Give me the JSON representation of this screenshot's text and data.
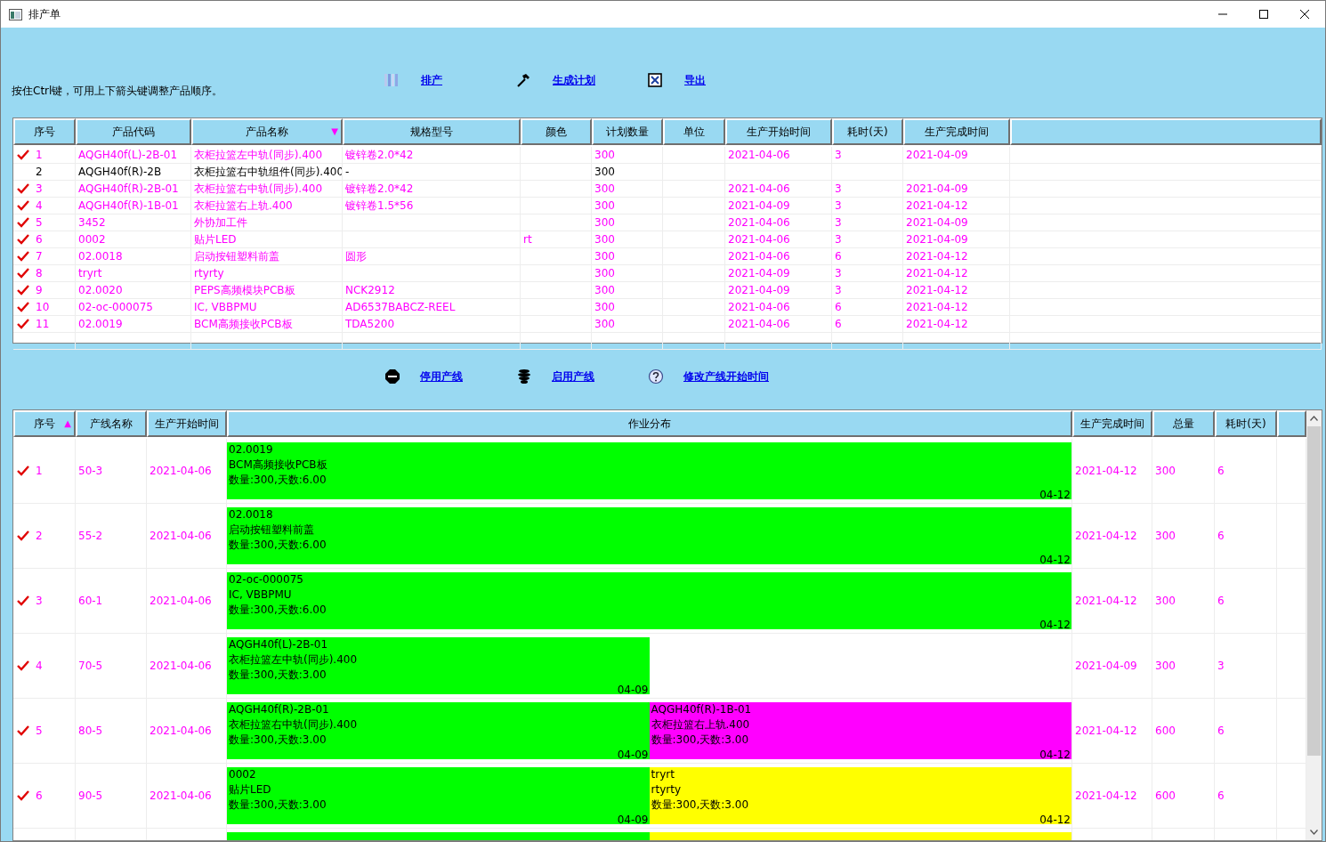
{
  "window": {
    "title": "排产单"
  },
  "hint": "按住Ctrl键，可用上下箭头键调整产品顺序。",
  "toolbar": [
    {
      "label": "排产",
      "kind": "schedule"
    },
    {
      "label": "生成计划",
      "kind": "plan"
    },
    {
      "label": "导出",
      "kind": "export"
    }
  ],
  "products": {
    "columns": [
      {
        "label": "序号"
      },
      {
        "label": "产品代码"
      },
      {
        "label": "产品名称",
        "sort_mark": "▼"
      },
      {
        "label": "规格型号"
      },
      {
        "label": "颜色"
      },
      {
        "label": "计划数量"
      },
      {
        "label": "单位"
      },
      {
        "label": "生产开始时间"
      },
      {
        "label": "耗时(天)"
      },
      {
        "label": "生产完成时间"
      }
    ],
    "rows": [
      {
        "checked": true,
        "no": "1",
        "code": "AQGH40f(L)-2B-01",
        "name": "衣柜拉篮左中轨(同步).400",
        "spec": "镀锌卷2.0*42",
        "qty": "300",
        "start": "2021-04-06",
        "days": "3",
        "end": "2021-04-09"
      },
      {
        "checked": false,
        "no": "2",
        "code": "AQGH40f(R)-2B",
        "name": "衣柜拉篮右中轨组件(同步).400",
        "spec": "-",
        "qty": "300"
      },
      {
        "checked": true,
        "no": "3",
        "code": "AQGH40f(R)-2B-01",
        "name": "衣柜拉篮右中轨(同步).400",
        "spec": "镀锌卷2.0*42",
        "qty": "300",
        "start": "2021-04-06",
        "days": "3",
        "end": "2021-04-09"
      },
      {
        "checked": true,
        "no": "4",
        "code": "AQGH40f(R)-1B-01",
        "name": "衣柜拉篮右上轨.400",
        "spec": "镀锌卷1.5*56",
        "qty": "300",
        "start": "2021-04-09",
        "days": "3",
        "end": "2021-04-12"
      },
      {
        "checked": true,
        "no": "5",
        "code": "3452",
        "name": "外协加工件",
        "qty": "300",
        "start": "2021-04-06",
        "days": "3",
        "end": "2021-04-09"
      },
      {
        "checked": true,
        "no": "6",
        "code": "0002",
        "name": "贴片LED",
        "colour_name": "rt",
        "qty": "300",
        "start": "2021-04-06",
        "days": "3",
        "end": "2021-04-09"
      },
      {
        "checked": true,
        "no": "7",
        "code": "02.0018",
        "name": "启动按钮塑料前盖",
        "spec": "圆形",
        "qty": "300",
        "start": "2021-04-06",
        "days": "6",
        "end": "2021-04-12"
      },
      {
        "checked": true,
        "no": "8",
        "code": "tryrt",
        "name": "rtyrty",
        "qty": "300",
        "start": "2021-04-09",
        "days": "3",
        "end": "2021-04-12"
      },
      {
        "checked": true,
        "no": "9",
        "code": "02.0020",
        "name": "PEPS高频模块PCB板",
        "spec": "NCK2912",
        "qty": "300",
        "start": "2021-04-09",
        "days": "3",
        "end": "2021-04-12"
      },
      {
        "checked": true,
        "no": "10",
        "code": "02-oc-000075",
        "name": "IC, VBBPMU",
        "spec": "AD6537BABCZ-REEL",
        "qty": "300",
        "start": "2021-04-06",
        "days": "6",
        "end": "2021-04-12"
      },
      {
        "checked": true,
        "no": "11",
        "code": "02.0019",
        "name": "BCM高频接收PCB板",
        "spec": "TDA5200",
        "qty": "300",
        "start": "2021-04-06",
        "days": "6",
        "end": "2021-04-12"
      }
    ]
  },
  "line_toolbar": [
    {
      "label": "停用产线",
      "kind": "stop"
    },
    {
      "label": "启用产线",
      "kind": "start"
    },
    {
      "label": "修改产线开始时间",
      "kind": "edit"
    }
  ],
  "lines": {
    "columns": [
      {
        "label": "序号",
        "sort_mark": "▲"
      },
      {
        "label": "产线名称"
      },
      {
        "label": "生产开始时间"
      },
      {
        "label": "作业分布"
      },
      {
        "label": "生产完成时间"
      },
      {
        "label": "总量"
      },
      {
        "label": "耗时(天)"
      }
    ],
    "rows": [
      {
        "checked": true,
        "no": "1",
        "line": "50-3",
        "start": "2021-04-06",
        "end": "2021-04-12",
        "total": "300",
        "days": "6",
        "bars": [
          {
            "code": "02.0019",
            "name": "BCM高频接收PCB板",
            "summary": "数量:300,天数:6.00",
            "finish": "04-12",
            "color": "#00ff00",
            "level": 1
          }
        ]
      },
      {
        "checked": true,
        "no": "2",
        "line": "55-2",
        "start": "2021-04-06",
        "end": "2021-04-12",
        "total": "300",
        "days": "6",
        "bars": [
          {
            "code": "02.0018",
            "name": "启动按钮塑料前盖",
            "summary": "数量:300,天数:6.00",
            "finish": "04-12",
            "color": "#00ff00",
            "level": 1
          }
        ]
      },
      {
        "checked": true,
        "no": "3",
        "line": "60-1",
        "start": "2021-04-06",
        "end": "2021-04-12",
        "total": "300",
        "days": "6",
        "bars": [
          {
            "code": "02-oc-000075",
            "name": "IC, VBBPMU",
            "summary": "数量:300,天数:6.00",
            "finish": "04-12",
            "color": "#00ff00",
            "level": 1
          }
        ]
      },
      {
        "checked": true,
        "no": "4",
        "line": "70-5",
        "start": "2021-04-06",
        "end": "2021-04-09",
        "total": "300",
        "days": "3",
        "bars": [
          {
            "code": "AQGH40f(L)-2B-01",
            "name": "衣柜拉篮左中轨(同步).400",
            "summary": "数量:300,天数:3.00",
            "finish": "04-09",
            "color": "#00ff00",
            "level": 0.5
          }
        ]
      },
      {
        "checked": true,
        "no": "5",
        "line": "80-5",
        "start": "2021-04-06",
        "end": "2021-04-12",
        "total": "600",
        "days": "6",
        "bars": [
          {
            "code": "AQGH40f(R)-2B-01",
            "name": "衣柜拉篮右中轨(同步).400",
            "summary": "数量:300,天数:3.00",
            "finish": "04-09",
            "color": "#00ff00",
            "level": 0.5
          },
          {
            "code": "AQGH40f(R)-1B-01",
            "name": "衣柜拉篮右上轨.400",
            "summary": "数量:300,天数:3.00",
            "finish": "04-12",
            "color": "#ff00ff",
            "level": 0.5
          }
        ]
      },
      {
        "checked": true,
        "no": "6",
        "line": "90-5",
        "start": "2021-04-06",
        "end": "2021-04-12",
        "total": "600",
        "days": "6",
        "bars": [
          {
            "code": "0002",
            "name": "贴片LED",
            "summary": "数量:300,天数:3.00",
            "finish": "04-09",
            "color": "#00ff00",
            "level": 0.5
          },
          {
            "code": "tryrt",
            "name": "rtyrty",
            "summary": "数量:300,天数:3.00",
            "finish": "04-12",
            "color": "#ffff00",
            "level": 0.5
          }
        ]
      },
      {
        "bars": [
          {
            "color": "#00ff00",
            "level": 0.5
          },
          {
            "color": "#ffff00",
            "level": 0.5
          }
        ]
      }
    ]
  }
}
